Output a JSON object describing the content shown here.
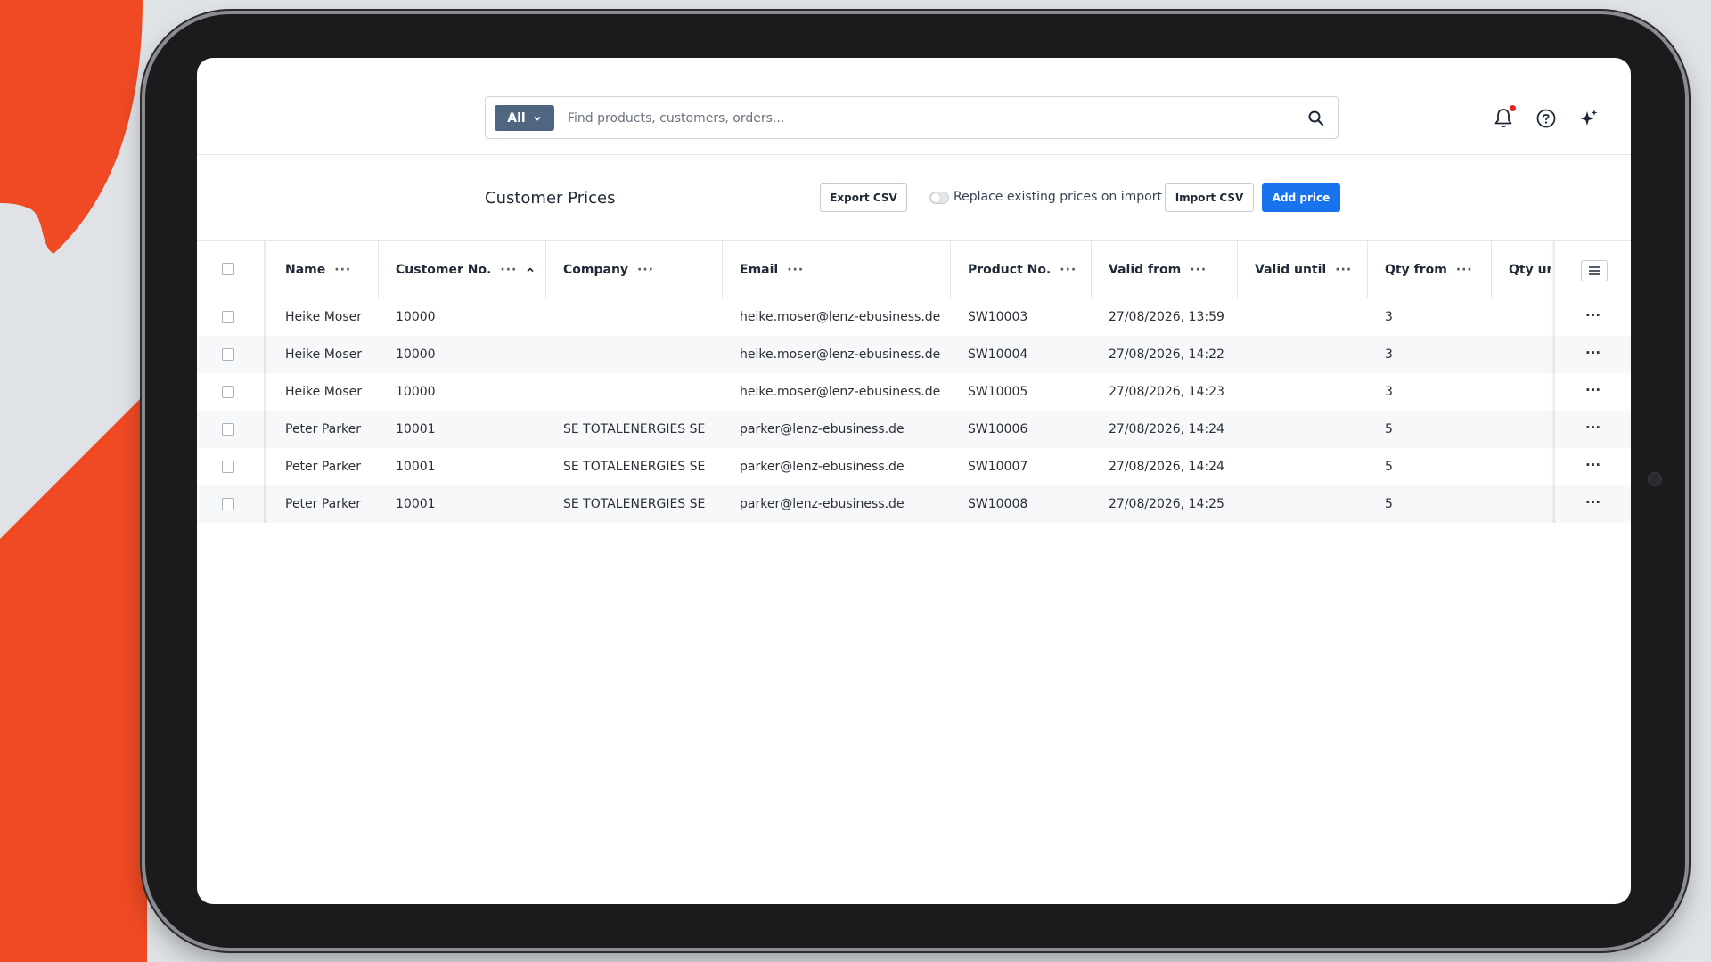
{
  "theme": {
    "accent": "#1a73ee",
    "scope_button_bg": "#4f6580",
    "brand_shape": "#f04a24"
  },
  "search": {
    "scope_label": "All",
    "placeholder": "Find products, customers, orders..."
  },
  "header_icons": [
    "bell-icon",
    "help-icon",
    "sparkle-icon"
  ],
  "page": {
    "title": "Customer Prices",
    "export_label": "Export CSV",
    "replace_toggle_label": "Replace existing prices on import",
    "import_label": "Import CSV",
    "add_label": "Add price"
  },
  "table": {
    "columns": [
      {
        "key": "name",
        "label": "Name"
      },
      {
        "key": "customer_no",
        "label": "Customer No.",
        "sorted": "asc"
      },
      {
        "key": "company",
        "label": "Company"
      },
      {
        "key": "email",
        "label": "Email"
      },
      {
        "key": "product_no",
        "label": "Product No."
      },
      {
        "key": "valid_from",
        "label": "Valid from"
      },
      {
        "key": "valid_until",
        "label": "Valid until"
      },
      {
        "key": "qty_from",
        "label": "Qty from"
      },
      {
        "key": "qty_until",
        "label": "Qty unti"
      }
    ],
    "rows": [
      {
        "name": "Heike Moser",
        "customer_no": "10000",
        "company": "",
        "email": "heike.moser@lenz-ebusiness.de",
        "product_no": "SW10003",
        "valid_from": "27/08/2026, 13:59",
        "valid_until": "",
        "qty_from": "3",
        "qty_until": ""
      },
      {
        "name": "Heike Moser",
        "customer_no": "10000",
        "company": "",
        "email": "heike.moser@lenz-ebusiness.de",
        "product_no": "SW10004",
        "valid_from": "27/08/2026, 14:22",
        "valid_until": "",
        "qty_from": "3",
        "qty_until": ""
      },
      {
        "name": "Heike Moser",
        "customer_no": "10000",
        "company": "",
        "email": "heike.moser@lenz-ebusiness.de",
        "product_no": "SW10005",
        "valid_from": "27/08/2026, 14:23",
        "valid_until": "",
        "qty_from": "3",
        "qty_until": ""
      },
      {
        "name": "Peter Parker",
        "customer_no": "10001",
        "company": "SE TOTALENERGIES SE",
        "email": "parker@lenz-ebusiness.de",
        "product_no": "SW10006",
        "valid_from": "27/08/2026, 14:24",
        "valid_until": "",
        "qty_from": "5",
        "qty_until": ""
      },
      {
        "name": "Peter Parker",
        "customer_no": "10001",
        "company": "SE TOTALENERGIES SE",
        "email": "parker@lenz-ebusiness.de",
        "product_no": "SW10007",
        "valid_from": "27/08/2026, 14:24",
        "valid_until": "",
        "qty_from": "5",
        "qty_until": ""
      },
      {
        "name": "Peter Parker",
        "customer_no": "10001",
        "company": "SE TOTALENERGIES SE",
        "email": "parker@lenz-ebusiness.de",
        "product_no": "SW10008",
        "valid_from": "27/08/2026, 14:25",
        "valid_until": "",
        "qty_from": "5",
        "qty_until": ""
      }
    ]
  }
}
